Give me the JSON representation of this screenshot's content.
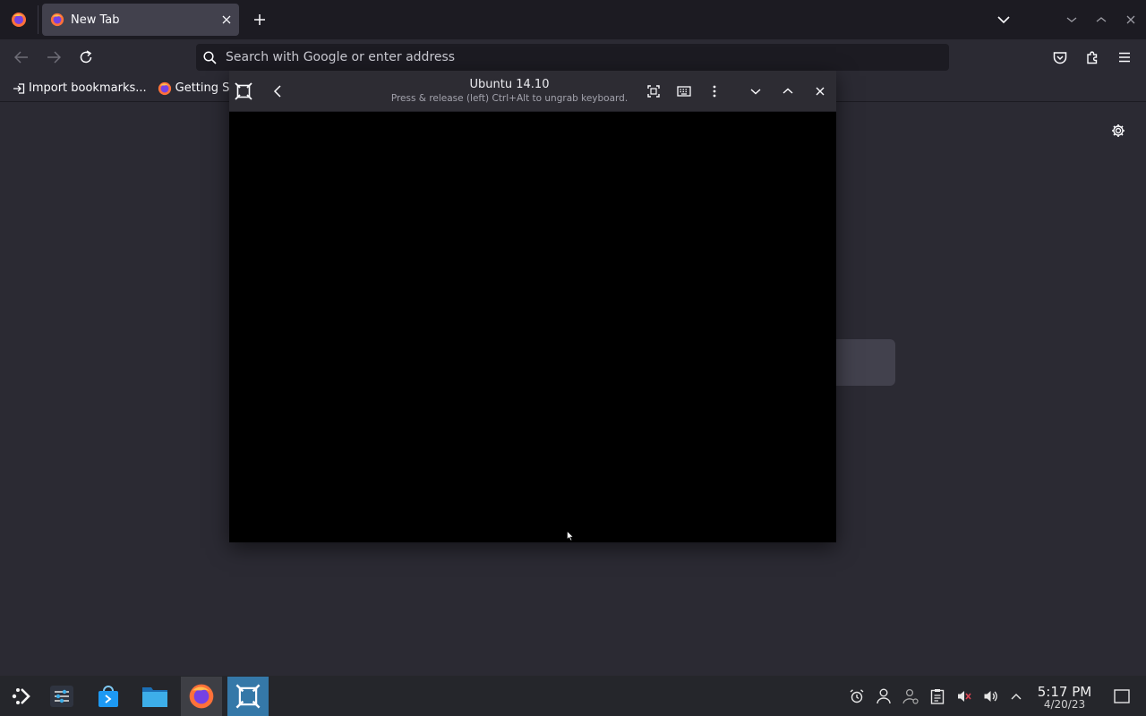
{
  "browser": {
    "tab_title": "New Tab",
    "url_placeholder": "Search with Google or enter address",
    "bookmarks": [
      {
        "label": "Import bookmarks..."
      },
      {
        "label": "Getting St"
      }
    ]
  },
  "vm_viewer": {
    "title": "Ubuntu 14.10",
    "subtitle": "Press & release (left) Ctrl+Alt to ungrab keyboard."
  },
  "taskbar": {
    "time": "5:17 PM",
    "date": "4/20/23",
    "apps": [
      "application-launcher-icon",
      "settings-icon",
      "discover-store-icon",
      "file-manager-icon",
      "firefox-icon",
      "virtual-machine-icon"
    ]
  },
  "colors": {
    "browser_bg": "#2b2a33",
    "tabstrip_bg": "#1c1b22",
    "taskbar_bg": "#25262b",
    "active_task": "#3578a8"
  }
}
